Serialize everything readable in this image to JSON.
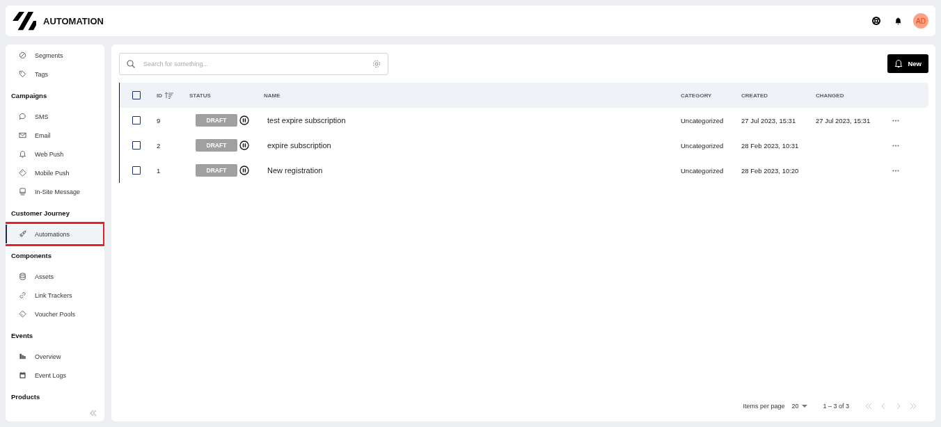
{
  "header": {
    "title": "AUTOMATION",
    "avatar": "AD"
  },
  "sidebar": {
    "sections": [
      {
        "items": [
          {
            "label": "Segments",
            "selected": false,
            "highlighted": false
          },
          {
            "label": "Tags",
            "selected": false,
            "highlighted": false
          }
        ]
      },
      {
        "heading": "Campaigns",
        "items": [
          {
            "label": "SMS",
            "selected": false,
            "highlighted": false
          },
          {
            "label": "Email",
            "selected": false,
            "highlighted": false
          },
          {
            "label": "Web Push",
            "selected": false,
            "highlighted": false
          },
          {
            "label": "Mobile Push",
            "selected": false,
            "highlighted": false
          },
          {
            "label": "In-Site Message",
            "selected": false,
            "highlighted": false
          }
        ]
      },
      {
        "heading": "Customer Journey",
        "items": [
          {
            "label": "Automations",
            "selected": true,
            "highlighted": true
          }
        ]
      },
      {
        "heading": "Components",
        "items": [
          {
            "label": "Assets",
            "selected": false,
            "highlighted": false
          },
          {
            "label": "Link Trackers",
            "selected": false,
            "highlighted": false
          },
          {
            "label": "Voucher Pools",
            "selected": false,
            "highlighted": false
          }
        ]
      },
      {
        "heading": "Events",
        "items": [
          {
            "label": "Overview",
            "selected": false,
            "highlighted": false
          },
          {
            "label": "Event Logs",
            "selected": false,
            "highlighted": false
          }
        ]
      },
      {
        "heading": "Products"
      }
    ]
  },
  "search": {
    "placeholder": "Search for something..."
  },
  "new_button": "New",
  "table": {
    "select_all_checked": false,
    "columns": [
      "ID",
      "STATUS",
      "NAME",
      "CATEGORY",
      "CREATED",
      "CHANGED"
    ],
    "rows": [
      {
        "checked": false,
        "id": "9",
        "status": "DRAFT",
        "name": "test expire subscription",
        "category": "Uncategorized",
        "created": "27 Jul 2023, 15:31",
        "changed": "27 Jul 2023, 15:31"
      },
      {
        "checked": false,
        "id": "2",
        "status": "DRAFT",
        "name": "expire subscription",
        "category": "Uncategorized",
        "created": "28 Feb 2023, 10:31"
      },
      {
        "checked": false,
        "id": "1",
        "status": "DRAFT",
        "name": "New registration",
        "category": "Uncategorized",
        "created": "28 Feb 2023, 10:20"
      }
    ]
  },
  "pagination": {
    "label": "Items per page",
    "page_size": "20",
    "range": "1 – 3 of 3",
    "nav": [
      {
        "kind": "first",
        "disabled": true
      },
      {
        "kind": "prev",
        "disabled": true
      },
      {
        "kind": "next",
        "disabled": true
      },
      {
        "kind": "last",
        "disabled": true
      }
    ]
  }
}
